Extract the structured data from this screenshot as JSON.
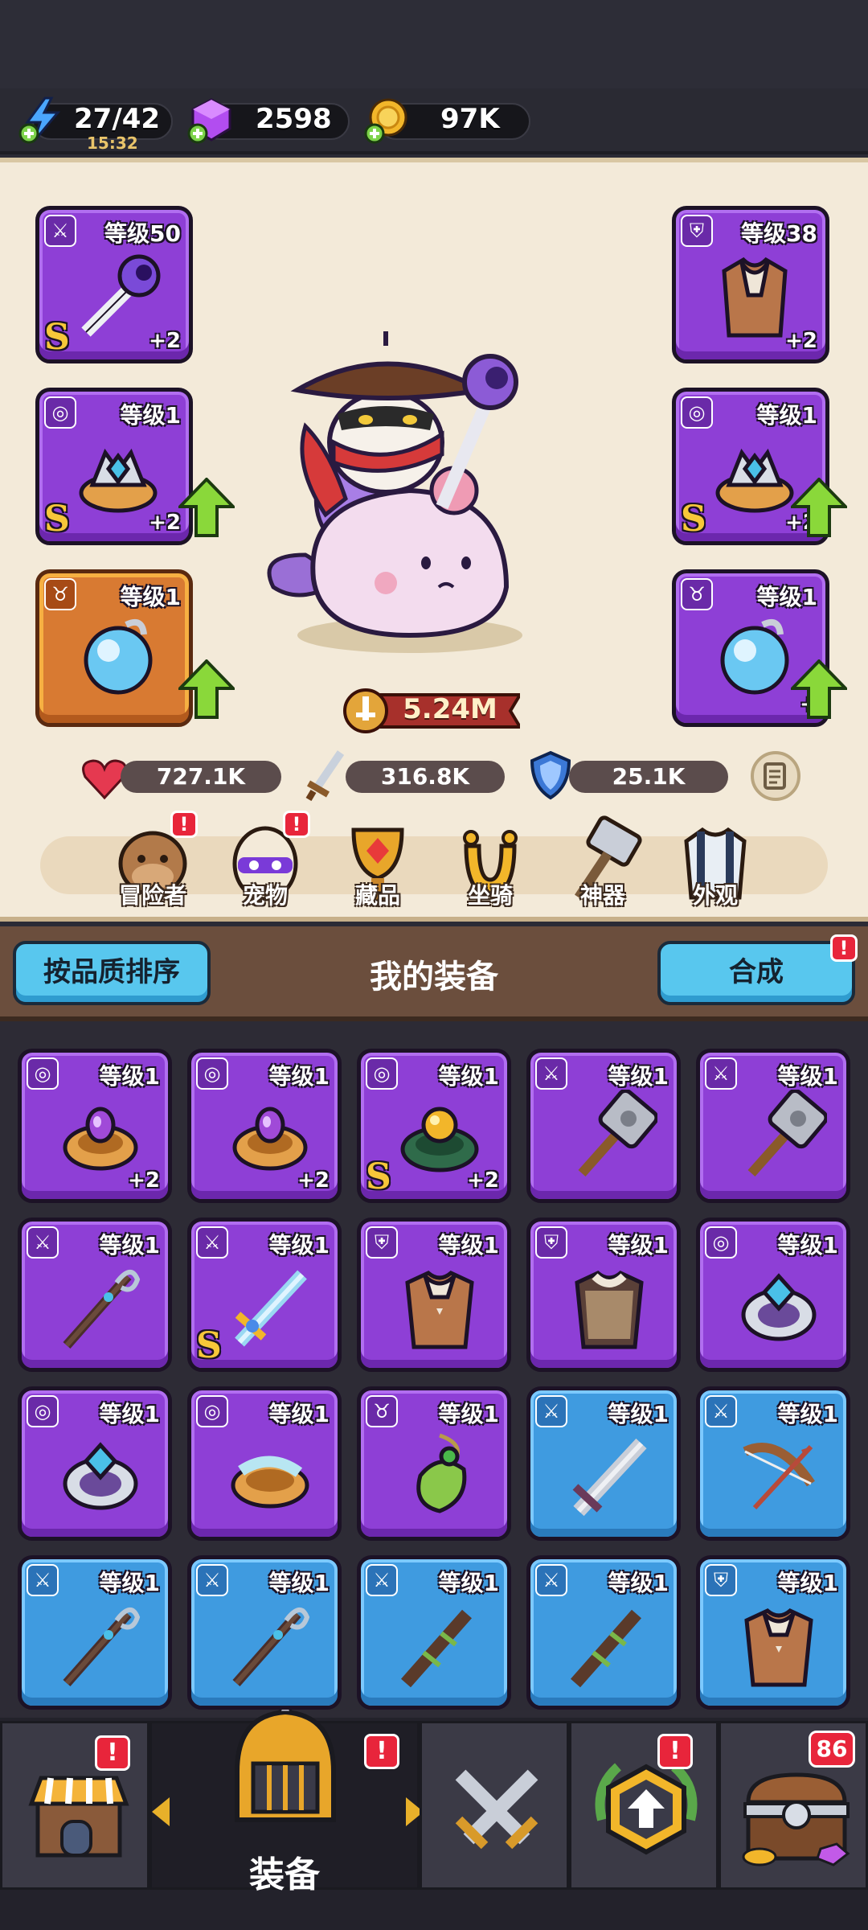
{
  "resources": {
    "energy": "27/42",
    "energy_timer": "15:32",
    "gems": "2598",
    "gold": "97K"
  },
  "hero": {
    "left_slots": [
      {
        "level": "等级50",
        "plus": "+2",
        "grade": "S",
        "type": "weapon",
        "rarity": "purple",
        "upgrade": false
      },
      {
        "level": "等级1",
        "plus": "+2",
        "grade": "S",
        "type": "ring",
        "rarity": "purple",
        "upgrade": true
      },
      {
        "level": "等级1",
        "plus": "",
        "grade": "",
        "type": "necklace",
        "rarity": "orange",
        "upgrade": true
      }
    ],
    "right_slots": [
      {
        "level": "等级38",
        "plus": "+2",
        "grade": "",
        "type": "armor",
        "rarity": "purple",
        "upgrade": false
      },
      {
        "level": "等级1",
        "plus": "+2",
        "grade": "S",
        "type": "ring",
        "rarity": "purple",
        "upgrade": true
      },
      {
        "level": "等级1",
        "plus": "+",
        "grade": "",
        "type": "necklace",
        "rarity": "purple",
        "upgrade": true
      }
    ],
    "power": "5.24M",
    "stats": {
      "hp": "727.1K",
      "attack": "316.8K",
      "defense": "25.1K"
    },
    "nav": [
      {
        "label": "冒险者",
        "alert": "!"
      },
      {
        "label": "宠物",
        "alert": "!"
      },
      {
        "label": "藏品",
        "alert": ""
      },
      {
        "label": "坐骑",
        "alert": ""
      },
      {
        "label": "神器",
        "alert": ""
      },
      {
        "label": "外观",
        "alert": ""
      }
    ]
  },
  "equip_header": {
    "sort_button": "按品质排序",
    "title": "我的装备",
    "merge_button": "合成",
    "merge_alert": "!"
  },
  "inventory": [
    {
      "level": "等级1",
      "plus": "+2",
      "grade": "",
      "type": "ring",
      "rarity": "purple",
      "art": "ring-purple-gem"
    },
    {
      "level": "等级1",
      "plus": "+2",
      "grade": "",
      "type": "ring",
      "rarity": "purple",
      "art": "ring-purple-gem"
    },
    {
      "level": "等级1",
      "plus": "+2",
      "grade": "S",
      "type": "ring",
      "rarity": "purple",
      "art": "ring-orange-gem"
    },
    {
      "level": "等级1",
      "plus": "",
      "grade": "",
      "type": "weapon",
      "rarity": "purple",
      "art": "hammer"
    },
    {
      "level": "等级1",
      "plus": "",
      "grade": "",
      "type": "weapon",
      "rarity": "purple",
      "art": "hammer"
    },
    {
      "level": "等级1",
      "plus": "",
      "grade": "",
      "type": "weapon",
      "rarity": "purple",
      "art": "staff"
    },
    {
      "level": "等级1",
      "plus": "",
      "grade": "S",
      "type": "weapon",
      "rarity": "purple",
      "art": "sword"
    },
    {
      "level": "等级1",
      "plus": "",
      "grade": "",
      "type": "armor",
      "rarity": "purple",
      "art": "armor"
    },
    {
      "level": "等级1",
      "plus": "",
      "grade": "",
      "type": "armor",
      "rarity": "purple",
      "art": "armor-dark"
    },
    {
      "level": "等级1",
      "plus": "",
      "grade": "",
      "type": "ring",
      "rarity": "purple",
      "art": "ring-silver"
    },
    {
      "level": "等级1",
      "plus": "",
      "grade": "",
      "type": "ring",
      "rarity": "purple",
      "art": "ring-silver"
    },
    {
      "level": "等级1",
      "plus": "",
      "grade": "",
      "type": "ring",
      "rarity": "purple",
      "art": "ring-gold"
    },
    {
      "level": "等级1",
      "plus": "",
      "grade": "",
      "type": "necklace",
      "rarity": "purple",
      "art": "pendant-green"
    },
    {
      "level": "等级1",
      "plus": "",
      "grade": "",
      "type": "weapon",
      "rarity": "blue",
      "art": "sword-plain"
    },
    {
      "level": "等级1",
      "plus": "",
      "grade": "",
      "type": "weapon",
      "rarity": "blue",
      "art": "bow"
    },
    {
      "level": "等级1",
      "plus": "",
      "grade": "",
      "type": "weapon",
      "rarity": "blue",
      "art": "staff"
    },
    {
      "level": "等级1",
      "plus": "",
      "grade": "",
      "type": "weapon",
      "rarity": "blue",
      "art": "staff"
    },
    {
      "level": "等级1",
      "plus": "",
      "grade": "",
      "type": "weapon",
      "rarity": "blue",
      "art": "club"
    },
    {
      "level": "等级1",
      "plus": "",
      "grade": "",
      "type": "weapon",
      "rarity": "blue",
      "art": "club"
    },
    {
      "level": "等级1",
      "plus": "",
      "grade": "",
      "type": "armor",
      "rarity": "blue",
      "art": "armor"
    }
  ],
  "bottom_nav": {
    "active_label": "装备",
    "tabs": [
      {
        "name": "shop",
        "alert": "!"
      },
      {
        "name": "equipment",
        "alert": "!"
      },
      {
        "name": "battle",
        "alert": ""
      },
      {
        "name": "upgrade",
        "alert": "!"
      },
      {
        "name": "chest",
        "alert": "86"
      }
    ]
  },
  "colors": {
    "purple_rarity": "#8e3fd6",
    "blue_rarity": "#3f9be0",
    "orange_rarity": "#d87a32",
    "button_blue": "#58c7ee",
    "alert_red": "#e8253b",
    "hero_bg": "#f3ead9"
  }
}
